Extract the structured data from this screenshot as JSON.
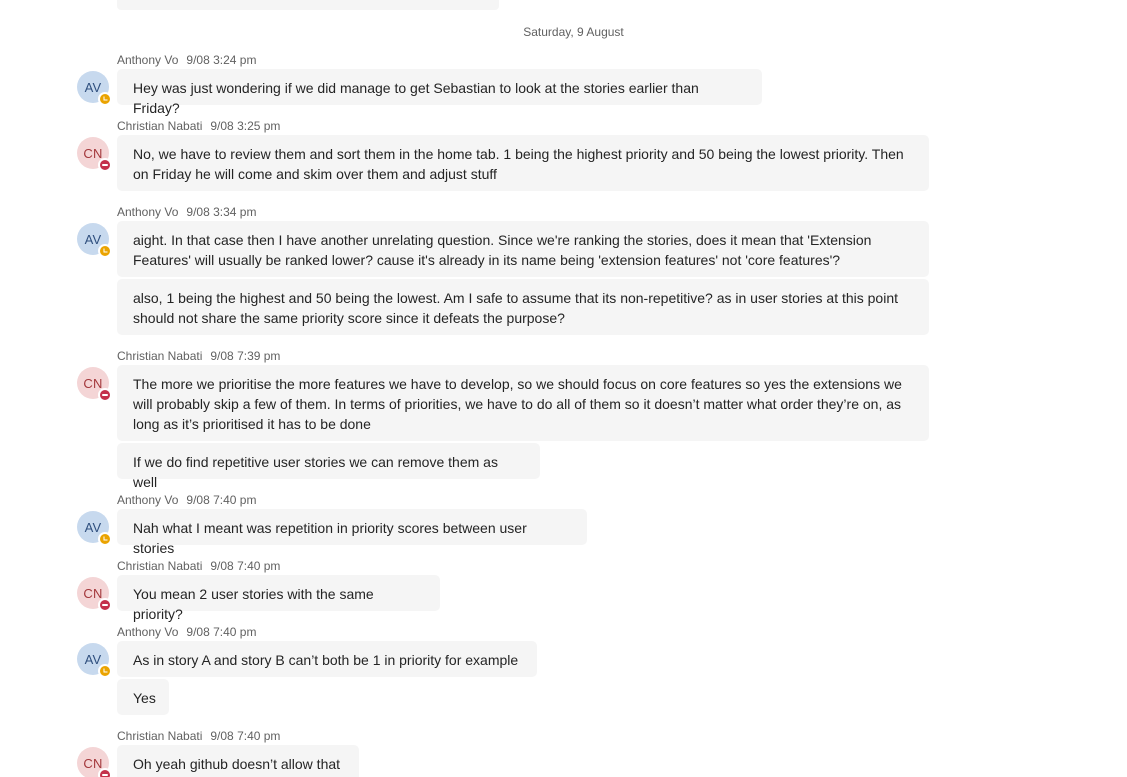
{
  "date_separator": "Saturday, 9 August",
  "messages": [
    {
      "author": "Anthony Vo",
      "time": "9/08 3:24 pm",
      "initials": "AV",
      "status": "away",
      "bubbles": [
        "Hey was just wondering if we did manage to get Sebastian to look at the stories earlier than Friday?"
      ]
    },
    {
      "author": "Christian Nabati",
      "time": "9/08 3:25 pm",
      "initials": "CN",
      "status": "do-not-disturb",
      "bubbles": [
        "No, we have to review them and sort them in the home tab. 1 being the highest priority and 50 being the lowest priority. Then on Friday he will come and skim over them and adjust stuff"
      ]
    },
    {
      "author": "Anthony Vo",
      "time": "9/08 3:34 pm",
      "initials": "AV",
      "status": "away",
      "bubbles": [
        "aight. In that case then I have another unrelating question. Since we're ranking the stories, does it mean that 'Extension Features' will usually be ranked lower? cause it's already in its name being 'extension features' not 'core features'?",
        "also, 1 being the highest and 50 being the lowest. Am I safe to assume that its non-repetitive? as in user stories at this point should not share the same priority score since it defeats the purpose?"
      ]
    },
    {
      "author": "Christian Nabati",
      "time": "9/08 7:39 pm",
      "initials": "CN",
      "status": "do-not-disturb",
      "bubbles": [
        "The more we prioritise the more features we have to develop, so we should focus on core features so yes the extensions we will probably skip a few of them. In terms of priorities, we have to do all of them so it doesn’t matter what order they’re on, as long as it’s prioritised it has to be done",
        "If we do find repetitive user stories we can remove them as well"
      ]
    },
    {
      "author": "Anthony Vo",
      "time": "9/08 7:40 pm",
      "initials": "AV",
      "status": "away",
      "bubbles": [
        "Nah what I meant was repetition in priority scores between user stories"
      ]
    },
    {
      "author": "Christian Nabati",
      "time": "9/08 7:40 pm",
      "initials": "CN",
      "status": "do-not-disturb",
      "bubbles": [
        "You mean 2 user stories with the same priority?"
      ]
    },
    {
      "author": "Anthony Vo",
      "time": "9/08 7:40 pm",
      "initials": "AV",
      "status": "away",
      "bubbles": [
        "As in story A and story B can’t both be 1 in priority for example",
        "Yes"
      ]
    },
    {
      "author": "Christian Nabati",
      "time": "9/08 7:40 pm",
      "initials": "CN",
      "status": "do-not-disturb",
      "bubbles": [
        "Oh yeah github doesn’t allow that"
      ]
    }
  ]
}
